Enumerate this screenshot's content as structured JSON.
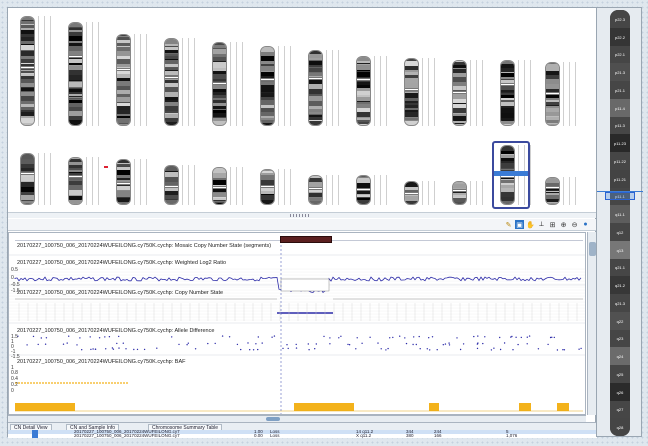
{
  "karyogram": {
    "chromosomes": [
      {
        "id": "1"
      },
      {
        "id": "2"
      },
      {
        "id": "3"
      },
      {
        "id": "4"
      },
      {
        "id": "5"
      },
      {
        "id": "6"
      },
      {
        "id": "7"
      },
      {
        "id": "8"
      },
      {
        "id": "9"
      },
      {
        "id": "10"
      },
      {
        "id": "11"
      },
      {
        "id": "12"
      },
      {
        "id": "13"
      },
      {
        "id": "14"
      },
      {
        "id": "15"
      },
      {
        "id": "16"
      },
      {
        "id": "17"
      },
      {
        "id": "18"
      },
      {
        "id": "19"
      },
      {
        "id": "20"
      },
      {
        "id": "21"
      },
      {
        "id": "22"
      },
      {
        "id": "X"
      },
      {
        "id": "Y"
      }
    ],
    "selected_chromosome": "X"
  },
  "tracks": [
    {
      "label": "20170227_100750_006_20170224WUFEILONG.cy750K.cychp: Mosaic Copy Number State (segments)"
    },
    {
      "label": "20170227_100750_006_20170224WUFEILONG.cy750K.cychp: Weighted Log2 Ratio"
    },
    {
      "label": "20170227_100750_006_20170224WUFEILONG.cy750K.cychp: Copy Number State"
    },
    {
      "label": "20170227_100750_006_20170224WUFEILONG.cy750K.cychp: Allele Difference"
    },
    {
      "label": "20170227_100750_006_20170224WUFEILONG.cy750K.cychp: BAF"
    }
  ],
  "axes": {
    "log2": [
      "0.5",
      "0",
      "-0.5",
      "-1.5"
    ],
    "allele": [
      "1.5",
      "1",
      "0",
      "-1",
      "-1.5"
    ],
    "baf": [
      "1",
      "0.8",
      "0.4",
      "0.2",
      "0"
    ]
  },
  "tabs": [
    {
      "label": "CN Detail View"
    },
    {
      "label": "CN and Sample Info"
    },
    {
      "label": "Chromosome Summary Table"
    }
  ],
  "table_rows": [
    {
      "file": "20170227_100750_006_20170224WUFEILONG.cy7",
      "cn": "1.00",
      "type": "Loss",
      "cyto": "14 q11.2",
      "size": "344",
      "markers": "244",
      "v": "5"
    },
    {
      "file": "20170227_100750_006_20170224WUFEILONG.cy7",
      "cn": "0.00",
      "type": "Loss",
      "cyto": "X q11.2",
      "size": "380",
      "markers": "166",
      "v": "1,076"
    }
  ],
  "ideogram": {
    "bands": [
      "p22.3",
      "p22.2",
      "p22.1",
      "p21.3",
      "p21.1",
      "p11.4",
      "p11.3",
      "p11.23",
      "p11.22",
      "p11.21",
      "p11.1",
      "q11.1",
      "q12",
      "q13",
      "q21.1",
      "q21.2",
      "q21.3",
      "q22",
      "q23",
      "q24",
      "q25",
      "q26",
      "q27",
      "q28"
    ]
  },
  "colors": {
    "cnv_line": "#2b2aa8",
    "baf_gold": "#f3b21b",
    "selection": "#3a7bd5",
    "region_marker": "#5b1f1f"
  }
}
